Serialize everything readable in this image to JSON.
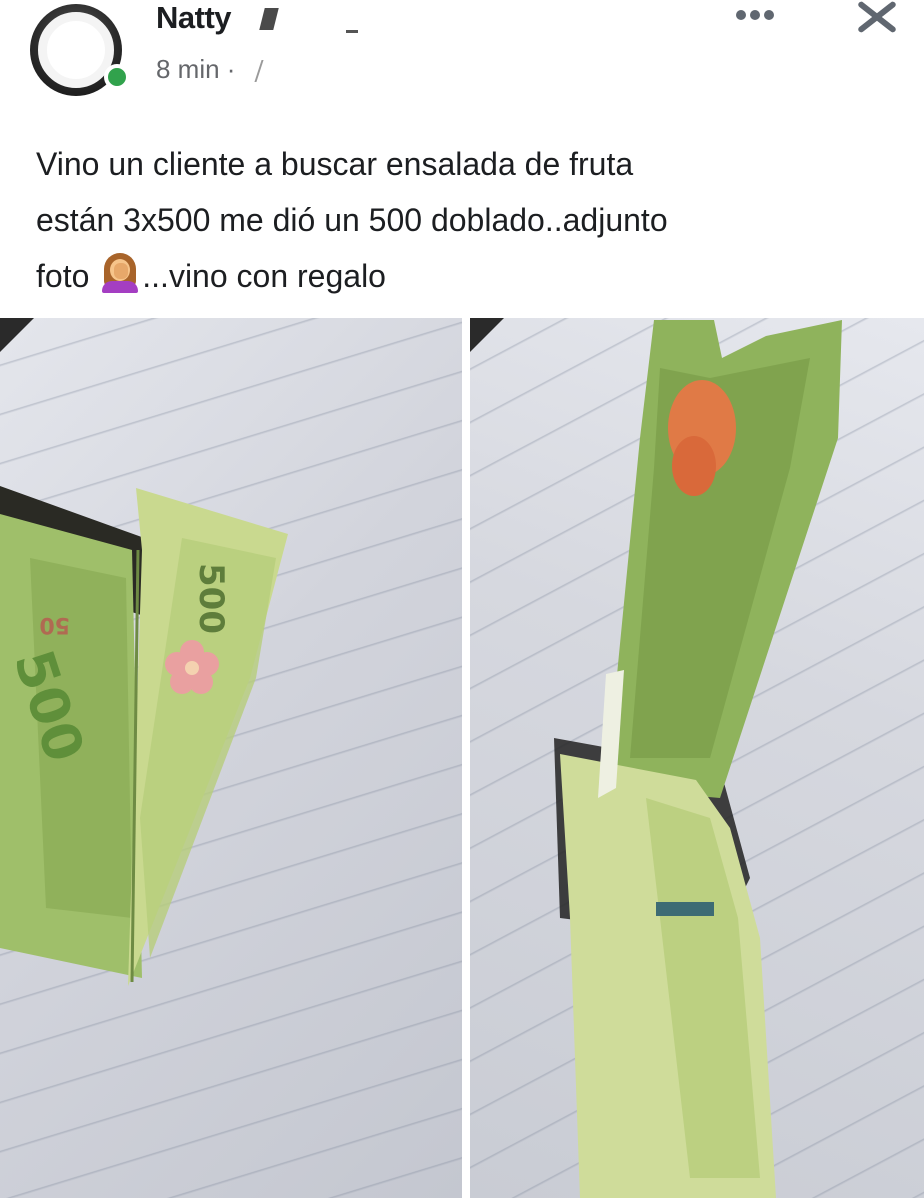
{
  "post": {
    "author_name": "Natty",
    "time": "8 min ·",
    "caption_lines": [
      "Vino un cliente a buscar ensalada de fruta",
      "están 3x500 me dió un 500 doblado..adjunto",
      "foto",
      "...vino con regalo"
    ],
    "emoji": "woman-facepalming-emoji"
  },
  "photos": [
    {
      "description_marks": {
        "banknote_values": [
          "500",
          "500",
          "50"
        ]
      }
    },
    {
      "description_marks": {
        "banknote_values": []
      }
    }
  ],
  "colors": {
    "online": "#31a24c",
    "icon_gray": "#606770",
    "note_green": "#9fbf6a",
    "note_dark_green": "#5f8f3a",
    "flower_pink": "#e9a0a0"
  },
  "icons": {
    "more": "more-horizontal-icon",
    "close": "close-icon",
    "privacy": "privacy-icon"
  }
}
